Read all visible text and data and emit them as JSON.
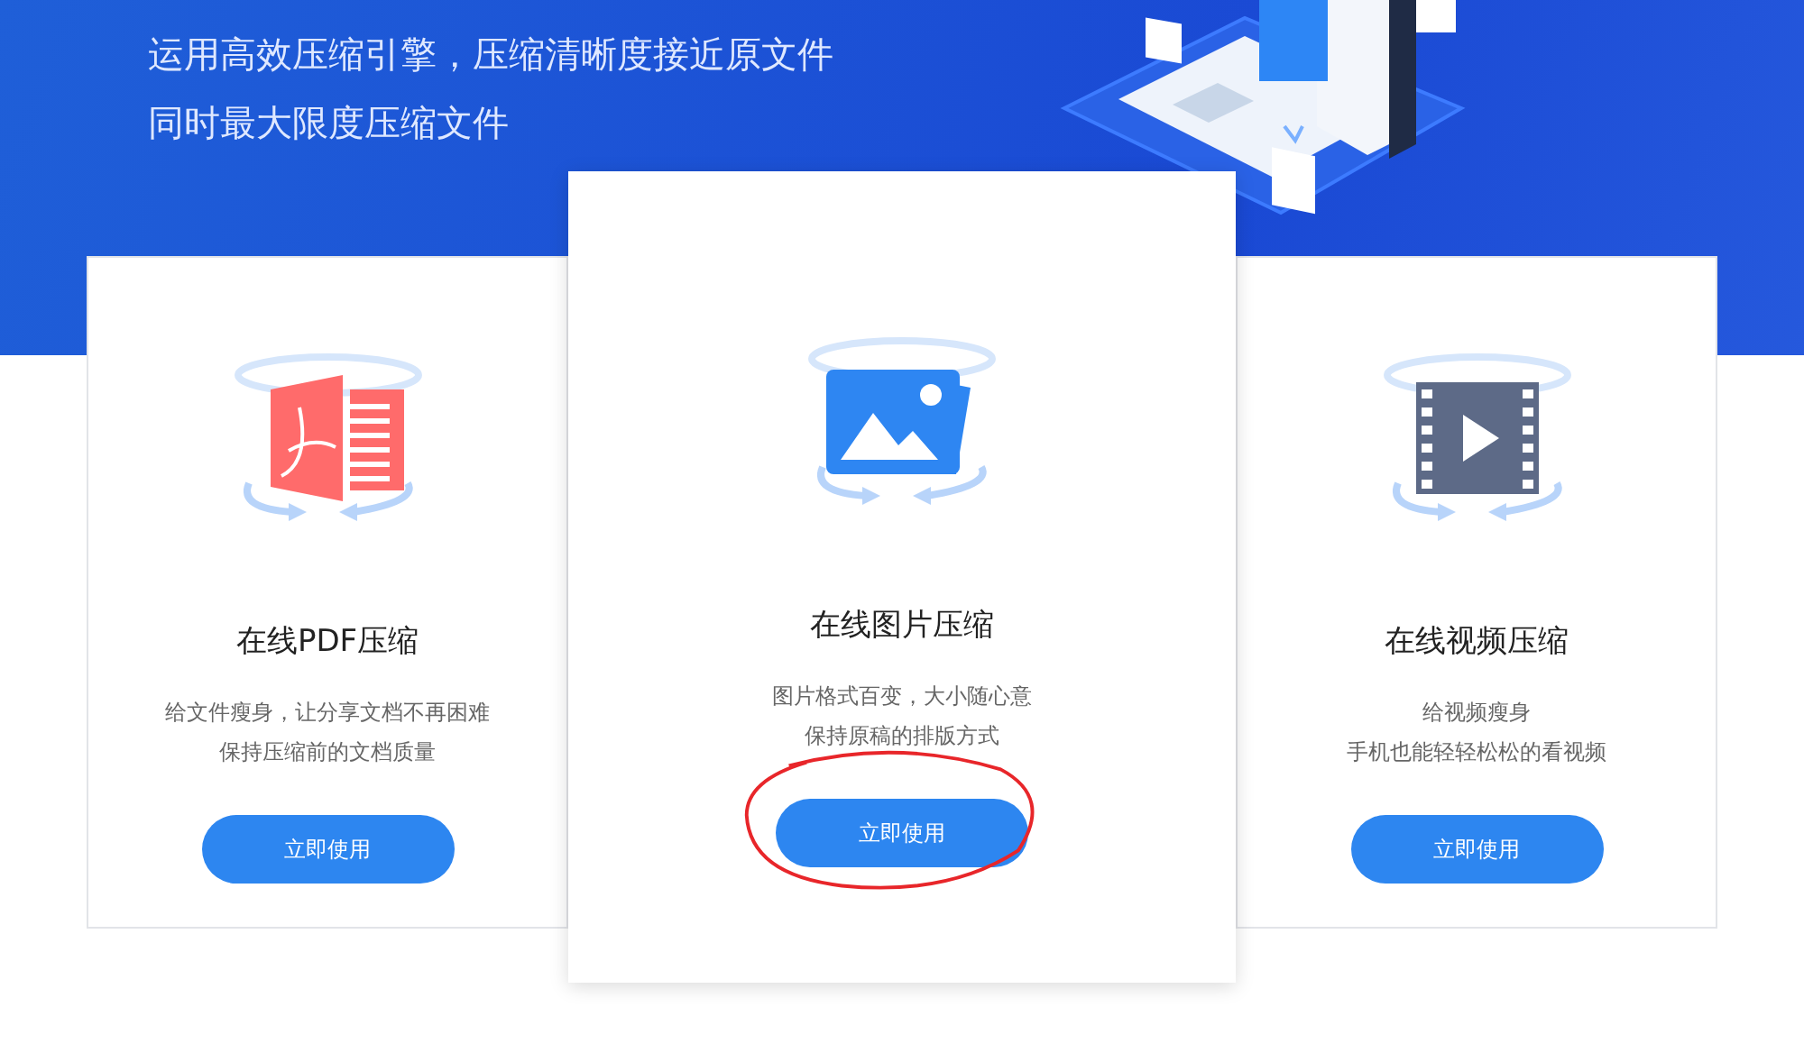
{
  "banner": {
    "lines": [
      "运用高效压缩引擎，压缩清晰度接近原文件",
      "同时最大限度压缩文件"
    ]
  },
  "cards": [
    {
      "kind": "pdf",
      "title": "在线PDF压缩",
      "lines": [
        "给文件瘦身，让分享文档不再困难",
        "保持压缩前的文档质量"
      ],
      "button": "立即使用",
      "selected": false
    },
    {
      "kind": "image",
      "title": "在线图片压缩",
      "lines": [
        "图片格式百变，大小随心意",
        "保持原稿的排版方式"
      ],
      "button": "立即使用",
      "selected": true
    },
    {
      "kind": "video",
      "title": "在线视频压缩",
      "lines": [
        "给视频瘦身",
        "手机也能轻轻松松的看视频"
      ],
      "button": "立即使用",
      "selected": false
    }
  ]
}
